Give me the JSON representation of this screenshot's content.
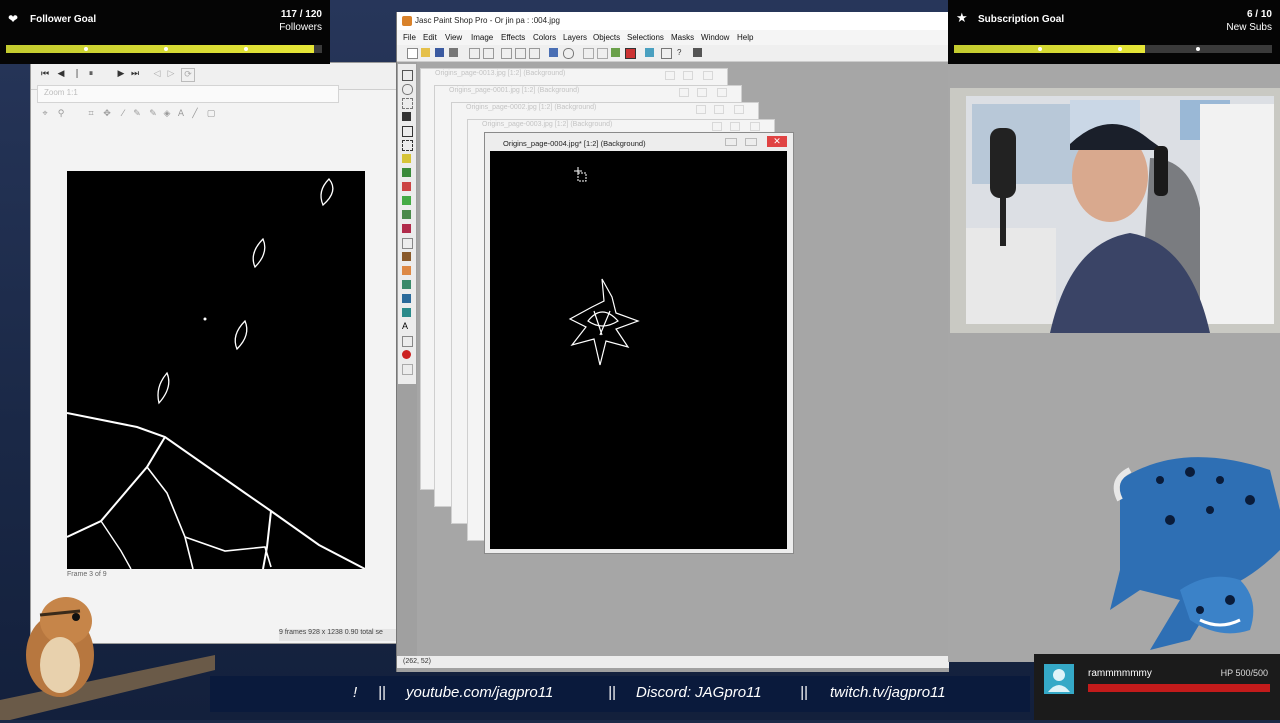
{
  "follower_goal": {
    "label": "Follower Goal",
    "count": "117 / 120",
    "unit": "Followers",
    "progress": 0.975
  },
  "sub_goal": {
    "label": "Subscription Goal",
    "count": "6 / 10",
    "unit": "New Subs",
    "progress": 0.6
  },
  "psp": {
    "title": "Jasc Paint Shop Pro - Or  jin  pa  : :004.jpg",
    "menu": [
      "File",
      "Edit",
      "View",
      "Image",
      "Effects",
      "Colors",
      "Layers",
      "Objects",
      "Selections",
      "Masks",
      "Window",
      "Help"
    ],
    "status": "(262, 52)",
    "doc_windows": [
      "Origins_page-0013.jpg [1:2] (Background)",
      "Origins_page-0001.jpg [1:2] (Background)",
      "Origins_page-0002.jpg [1:2] (Background)",
      "Origins_page-0003.jpg [1:2] (Background)"
    ],
    "active_doc": "Origins_page-0004.jpg* [1:2] (Background)"
  },
  "animation": {
    "zoom": "Zoom 1:1",
    "frame_label": "Frame 3 of 9",
    "status": "9 frames   928 x 1238   0.90 total se"
  },
  "ticker": [
    "!",
    "||",
    "youtube.com/jagpro11",
    "||",
    "Discord: JAGpro11",
    "||",
    "twitch.tv/jagpro11"
  ],
  "hp_widget": {
    "username": "rammmmmmy",
    "hp": "HP 500/500"
  },
  "colors": {
    "goal_fill": "#d8dc35",
    "hp_bar": "#c31b1b",
    "ticker_bg": "#0a1a3c",
    "avatar": "#35a9c7"
  }
}
